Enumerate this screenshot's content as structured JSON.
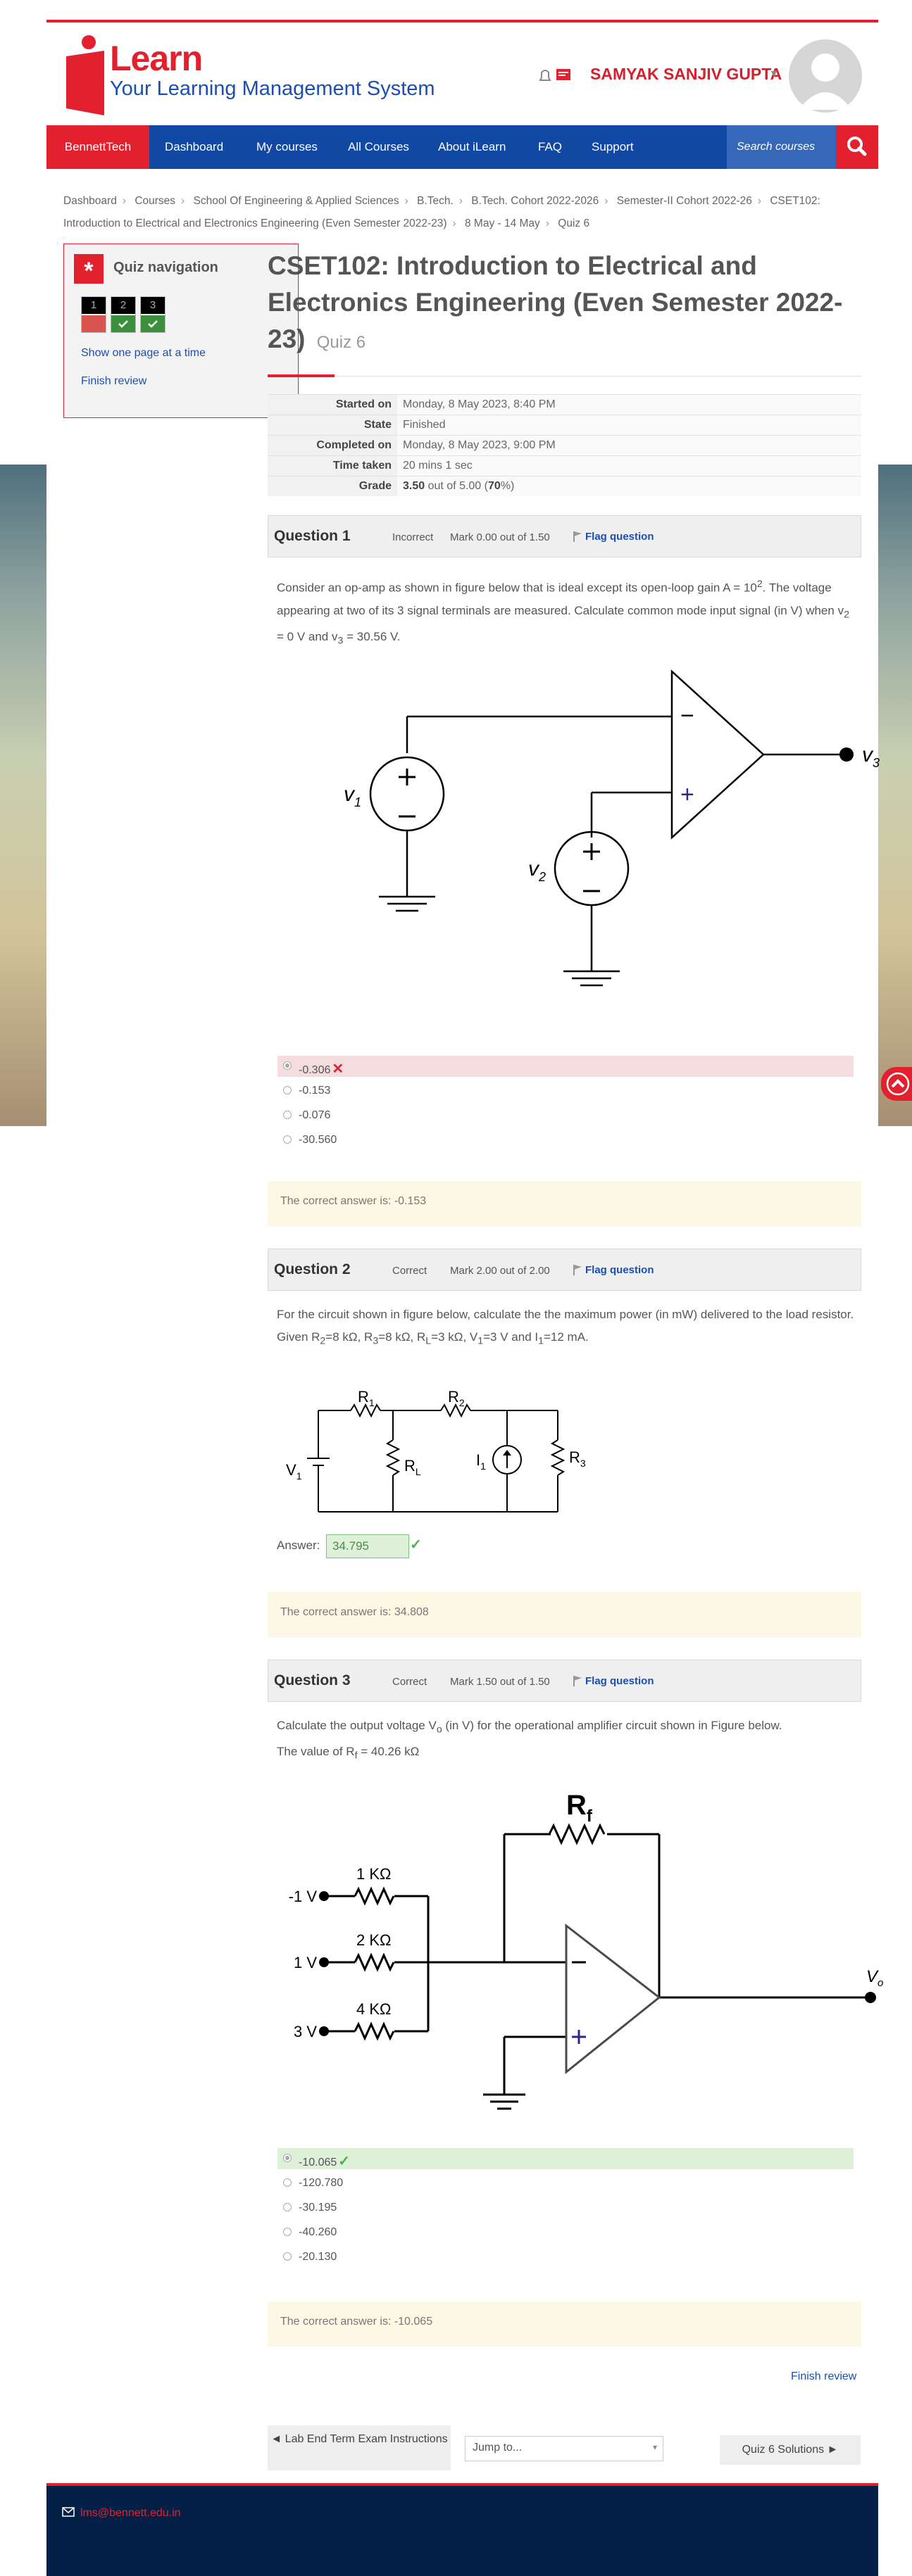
{
  "header": {
    "logo_learn": "Learn",
    "logo_tagline": "Your Learning Management System",
    "user_name": "SAMYAK SANJIV GUPTA"
  },
  "nav": {
    "brand": "BennettTech",
    "items": [
      "Dashboard",
      "My courses",
      "All Courses",
      "About iLearn",
      "FAQ",
      "Support"
    ],
    "search_placeholder": "Search courses"
  },
  "breadcrumb": [
    "Dashboard",
    "Courses",
    "School Of Engineering & Applied Sciences",
    "B.Tech.",
    "B.Tech. Cohort 2022-2026",
    "Semester-II Cohort 2022-26",
    "CSET102: Introduction to Electrical and Electronics Engineering (Even Semester 2022-23)",
    "8 May - 14 May",
    "Quiz 6"
  ],
  "quiz_nav": {
    "title": "Quiz navigation",
    "buttons": [
      {
        "num": "1",
        "state": "incorrect"
      },
      {
        "num": "2",
        "state": "correct"
      },
      {
        "num": "3",
        "state": "correct"
      }
    ],
    "show_one_page": "Show one page at a time",
    "finish_review": "Finish review"
  },
  "page": {
    "title": "CSET102: Introduction to Electrical and Electronics Engineering (Even Semester 2022-23)",
    "subtitle": "Quiz 6"
  },
  "summary": [
    {
      "key": "Started on",
      "value": "Monday, 8 May 2023, 8:40 PM"
    },
    {
      "key": "State",
      "value": "Finished"
    },
    {
      "key": "Completed on",
      "value": "Monday, 8 May 2023, 9:00 PM"
    },
    {
      "key": "Time taken",
      "value": "20 mins 1 sec"
    },
    {
      "key": "Grade",
      "value_bold": "3.50",
      "value_mid": " out of 5.00 (",
      "value_pct": "70",
      "value_end": "%)"
    }
  ],
  "questions": {
    "q1": {
      "number": "Question 1",
      "state": "Incorrect",
      "mark": "Mark 0.00 out of 1.50",
      "flag": "Flag question",
      "text_a": "Consider an op-amp as shown in figure below that is ideal except its open-loop gain A = 10",
      "text_a_sup": "2",
      "text_b": ". The voltage appearing at two of its 3 signal terminals are measured. Calculate common mode input signal (in V) when v",
      "text_b_sub": "2",
      "text_c": " = 0 V and v",
      "text_c_sub": "3",
      "text_d": " = 30.56 V.",
      "fig_labels": {
        "v1": "v",
        "v1_sub": "1",
        "v2": "v",
        "v2_sub": "2",
        "v3": "v",
        "v3_sub": "3",
        "minus": "−",
        "plus": "+"
      },
      "options": [
        "-0.306",
        "-0.153",
        "-0.076",
        "-30.560"
      ],
      "selected": 0,
      "feedback": "The correct answer is: -0.153"
    },
    "q2": {
      "number": "Question 2",
      "state": "Correct",
      "mark": "Mark 2.00 out of 2.00",
      "flag": "Flag question",
      "text_a": "For the circuit shown in figure below, calculate the the maximum power (in mW) delivered to the load resistor. Given R",
      "sub_2": "2",
      "t1": "=8 kΩ, R",
      "sub_3": "3",
      "t2": "=8 kΩ, R",
      "sub_L": "L",
      "t3": "=3 kΩ, V",
      "sub_1": "1",
      "t4": "=3 V and I",
      "sub_I1": "1",
      "t5": "=12 mA.",
      "fig_labels": {
        "R": "R",
        "one": "1",
        "two": "2",
        "three": "3",
        "L": "L",
        "V": "V",
        "I": "I"
      },
      "answer_label": "Answer:",
      "answer_value": "34.795",
      "feedback": "The correct answer is: 34.808"
    },
    "q3": {
      "number": "Question 3",
      "state": "Correct",
      "mark": "Mark 1.50 out of 1.50",
      "flag": "Flag question",
      "text_a": "Calculate the output voltage V",
      "sub_o": "o",
      "text_b": " (in V)  for the operational amplifier circuit shown in Figure below.",
      "text_c": "The value of R",
      "sub_f": "f",
      "text_d": " = 40.26 kΩ",
      "fig_labels": {
        "rf": "R",
        "rf_sub": "f",
        "r1": "1 KΩ",
        "r2": "2 KΩ",
        "r3": "4 KΩ",
        "in1": "-1 V",
        "in2": "1 V",
        "in3": "3 V",
        "vo": "V",
        "vo_sub": "o"
      },
      "options": [
        "-10.065",
        "-120.780",
        "-30.195",
        "-40.260",
        "-20.130"
      ],
      "selected": 0,
      "feedback": "The correct answer is: -10.065"
    }
  },
  "footer_nav": {
    "finish_review": "Finish review",
    "prev": "◄ Lab End Term Exam Instructions",
    "jump": "Jump to...",
    "next": "Quiz 6 Solutions ►"
  },
  "footer": {
    "email": "lms@bennett.edu.in"
  }
}
